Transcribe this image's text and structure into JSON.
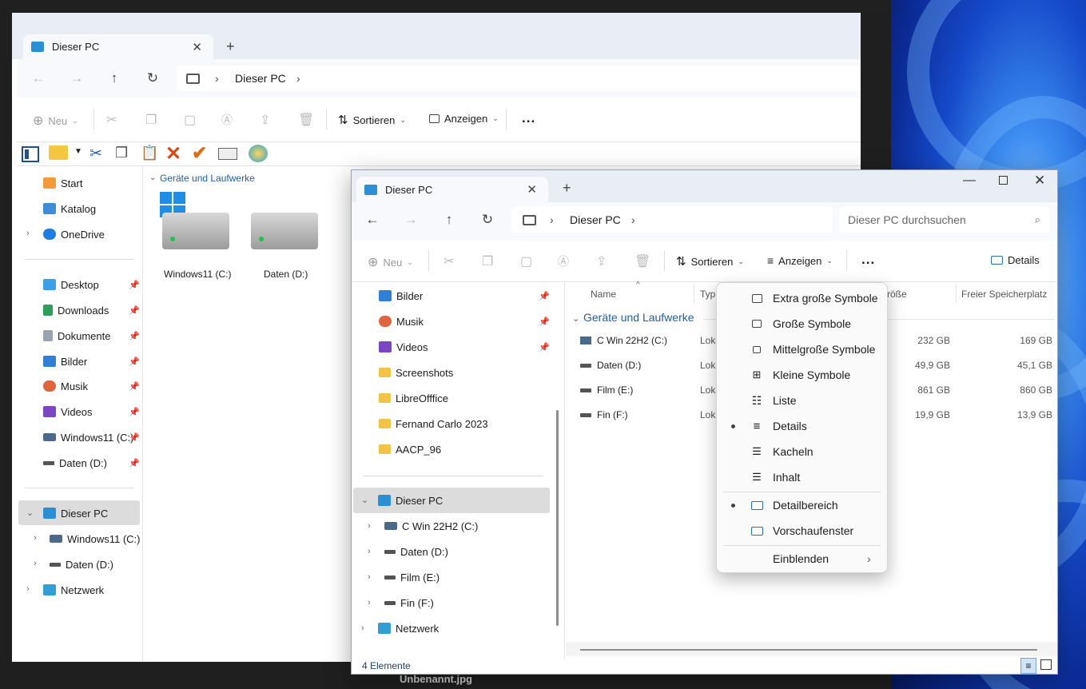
{
  "caption": "Unbenannt.jpg",
  "back": {
    "tab_title": "Dieser PC",
    "breadcrumb": [
      "Dieser PC"
    ],
    "cmd": {
      "new": "Neu",
      "sort": "Sortieren",
      "view": "Anzeigen",
      "more": "..."
    },
    "nav": {
      "start": "Start",
      "katalog": "Katalog",
      "onedrive": "OneDrive",
      "quick": [
        "Desktop",
        "Downloads",
        "Dokumente",
        "Bilder",
        "Musik",
        "Videos",
        "Windows11 (C:)",
        "Daten (D:)"
      ],
      "thispc": "Dieser PC",
      "drives": [
        "Windows11 (C:)",
        "Daten (D:)"
      ],
      "network": "Netzwerk"
    },
    "group": "Geräte und Laufwerke",
    "tiles": [
      "Windows11 (C:)",
      "Daten (D:)"
    ]
  },
  "front": {
    "tab_title": "Dieser PC",
    "breadcrumb": [
      "Dieser PC"
    ],
    "search_placeholder": "Dieser PC durchsuchen",
    "cmd": {
      "new": "Neu",
      "sort": "Sortieren",
      "view": "Anzeigen",
      "more": "...",
      "details": "Details"
    },
    "nav": {
      "quick": [
        "Bilder",
        "Musik",
        "Videos",
        "Screenshots",
        "LibreOfffice",
        "Fernand Carlo 2023",
        "AACP_96"
      ],
      "thispc": "Dieser PC",
      "drives": [
        "C Win 22H2 (C:)",
        "Daten (D:)",
        "Film (E:)",
        "Fin (F:)"
      ],
      "network": "Netzwerk"
    },
    "columns": {
      "name": "Name",
      "type": "Typ",
      "size": "tgröße",
      "free": "Freier Speicherplatz"
    },
    "group": "Geräte und Laufwerke",
    "rows": [
      {
        "name": "C Win 22H2 (C:)",
        "type": "Loka",
        "size": "232 GB",
        "free": "169 GB"
      },
      {
        "name": "Daten (D:)",
        "type": "Loka",
        "size": "49,9 GB",
        "free": "45,1 GB"
      },
      {
        "name": "Film (E:)",
        "type": "Loka",
        "size": "861 GB",
        "free": "860 GB"
      },
      {
        "name": "Fin (F:)",
        "type": "Loka",
        "size": "19,9 GB",
        "free": "13,9 GB"
      }
    ],
    "status": "4 Elemente"
  },
  "menu": {
    "items": [
      "Extra große Symbole",
      "Große Symbole",
      "Mittelgroße Symbole",
      "Kleine Symbole",
      "Liste",
      "Details",
      "Kacheln",
      "Inhalt"
    ],
    "pane": [
      "Detailbereich",
      "Vorschaufenster"
    ],
    "show": "Einblenden",
    "selected_view": "Details",
    "selected_pane": "Detailbereich"
  },
  "colors": {
    "accent": "#0067c0",
    "selection": "#dcdcdc",
    "tabstrip": "#e9eef5"
  }
}
